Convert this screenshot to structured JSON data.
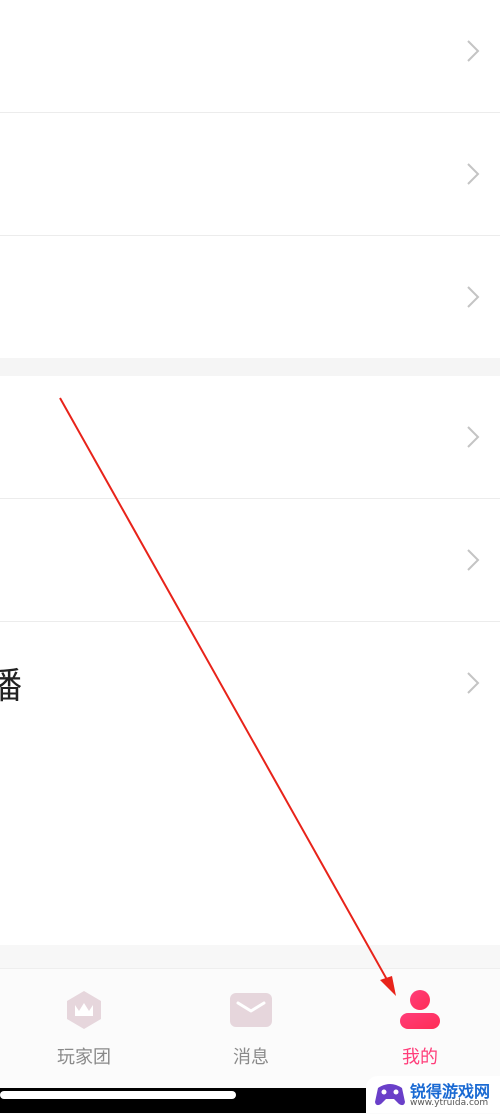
{
  "list": {
    "rows": [
      {
        "label": ""
      },
      {
        "label": ""
      },
      {
        "label": ""
      },
      {
        "label": ""
      },
      {
        "label": ""
      },
      {
        "label": "播"
      }
    ],
    "chevron_icon": "chevron-right-icon"
  },
  "tabbar": {
    "tabs": [
      {
        "label": "玩家团",
        "icon": "crown-shield-icon",
        "active": false
      },
      {
        "label": "消息",
        "icon": "envelope-icon",
        "active": false
      },
      {
        "label": "我的",
        "icon": "profile-icon",
        "active": true
      }
    ],
    "active_color": "#ff3d7a",
    "inactive_icon_color": "#e6d6dc"
  },
  "watermark": {
    "brand": "锐得游戏网",
    "url": "www.ytruida.com"
  },
  "annotation": {
    "arrow_color": "#e8231a"
  }
}
